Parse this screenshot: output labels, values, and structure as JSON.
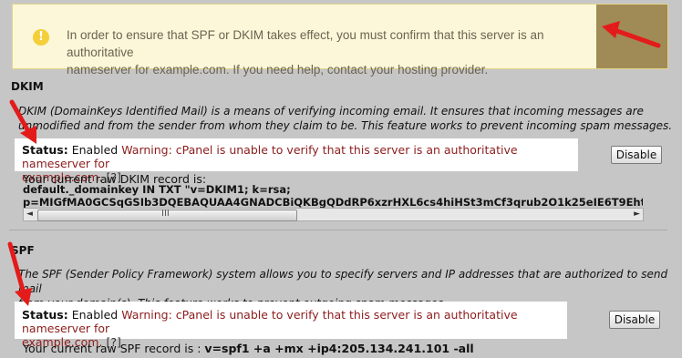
{
  "alert": {
    "icon": "warning-icon",
    "line1": "In order to ensure that SPF or DKIM takes effect, you must confirm that this server is an authoritative",
    "line2": "nameserver for example.com. If you need help, contact your hosting provider."
  },
  "dkim": {
    "title": "DKIM",
    "desc_line1": "DKIM (DomainKeys Identified Mail) is a means of verifying incoming email. It ensures that incoming messages are",
    "desc_line2": "unmodified and from the sender from whom they claim to be. This feature works to prevent incoming spam messages.",
    "status_label": "Status:",
    "status_value": "Enabled",
    "warning_line1": "Warning: cPanel is unable to verify that this server is an authoritative nameserver for",
    "warning_line2": "example.com.",
    "help": "[?]",
    "button": "Disable",
    "record_label": "Your current raw DKIM record is:",
    "record_line1": "default._domainkey IN TXT \"v=DKIM1; k=rsa;",
    "record_line2": "p=MIGfMA0GCSqGSIb3DQEBAQUAA4GNADCBiQKBgQDdRP6xzrHXL6cs4hiHSt3mCf3qrub2O1k25eIE6T9Eht8rr",
    "scroll_left": "◄",
    "scroll_grip": "III",
    "scroll_right": "►"
  },
  "spf": {
    "title": "SPF",
    "desc_line1": "The SPF (Sender Policy Framework) system allows you to specify servers and IP addresses that are authorized to send mail",
    "desc_line2": "from your domain(s). This feature works to prevent outgoing spam messages.",
    "status_label": "Status:",
    "status_value": "Enabled",
    "warning_line1": "Warning: cPanel is unable to verify that this server is an authoritative nameserver for",
    "warning_line2": "example.com.",
    "help": "[?]",
    "button": "Disable",
    "record_label": "Your current raw SPF record is :",
    "record_value": "v=spf1 +a +mx +ip4:205.134.241.101 -all"
  },
  "colors": {
    "warning_text": "#8c1c1c",
    "annotation_arrow": "#e31b1b",
    "alert_background": "#fbf7d8",
    "page_background": "#c6c6c6"
  }
}
